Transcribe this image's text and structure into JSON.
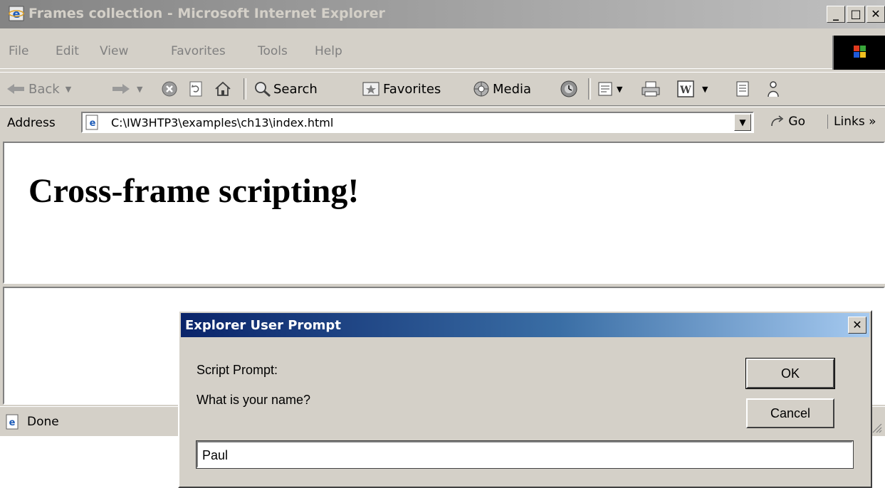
{
  "window": {
    "title": "Frames collection - Microsoft Internet Explorer",
    "minimize": "_",
    "maximize": "□",
    "close": "✕"
  },
  "menu": [
    "File",
    "Edit",
    "View",
    "Favorites",
    "Tools",
    "Help"
  ],
  "toolbar": {
    "back": "Back",
    "search": "Search",
    "favorites": "Favorites",
    "media": "Media"
  },
  "address": {
    "label": "Address",
    "url": "C:\\IW3HTP3\\examples\\ch13\\index.html",
    "go": "Go",
    "links": "Links »"
  },
  "page": {
    "heading": "Cross-frame scripting!"
  },
  "status": {
    "text": "Done"
  },
  "dialog": {
    "title": "Explorer User Prompt",
    "close": "✕",
    "label1": "Script Prompt:",
    "label2": "What is your name?",
    "ok": "OK",
    "cancel": "Cancel",
    "input_value": "Paul"
  }
}
